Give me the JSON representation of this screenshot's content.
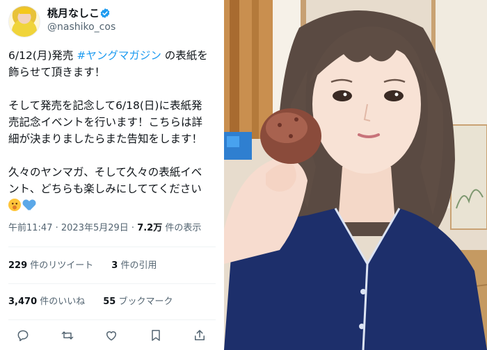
{
  "tweet": {
    "display_name": "桃月なしこ",
    "handle": "@nashiko_cos",
    "body": {
      "line1_prefix": "6/12(月)発売 ",
      "hashtag": "#ヤングマガジン",
      "line1_suffix": " の表紙を",
      "line2": "飾らせて頂きます！",
      "line3": "そして発売を記念して6/18(日)に表紙発",
      "line4": "売記念イベントを行います！こちらは詳",
      "line5": "細が決まりましたらまた告知をします！",
      "line6": "久々のヤンマガ、そして久々の表紙イベ",
      "line7": "ント、どちらも楽しみにしててください"
    },
    "meta": {
      "time": "午前11:47",
      "sep1": " · ",
      "date": "2023年5月29日",
      "sep2": " · ",
      "views_count": "7.2万",
      "views_label": " 件の表示"
    },
    "stats": {
      "retweets_count": "229",
      "retweets_label": " 件のリツイート",
      "quotes_count": "3",
      "quotes_label": " 件の引用",
      "likes_count": "3,470",
      "likes_label": " 件のいいね",
      "bookmarks_count": "55",
      "bookmarks_label": " ブックマーク"
    },
    "icons": {
      "verified": "verified-badge-icon",
      "reply": "reply-icon",
      "retweet": "retweet-icon",
      "like": "heart-icon",
      "bookmark": "bookmark-icon",
      "share": "share-icon",
      "emoji_1": "face-with-hand-over-mouth-emoji",
      "emoji_2": "blue-heart-emoji"
    },
    "colors": {
      "accent": "#1d9bf0",
      "text": "#0f1419",
      "secondary": "#536471"
    }
  }
}
